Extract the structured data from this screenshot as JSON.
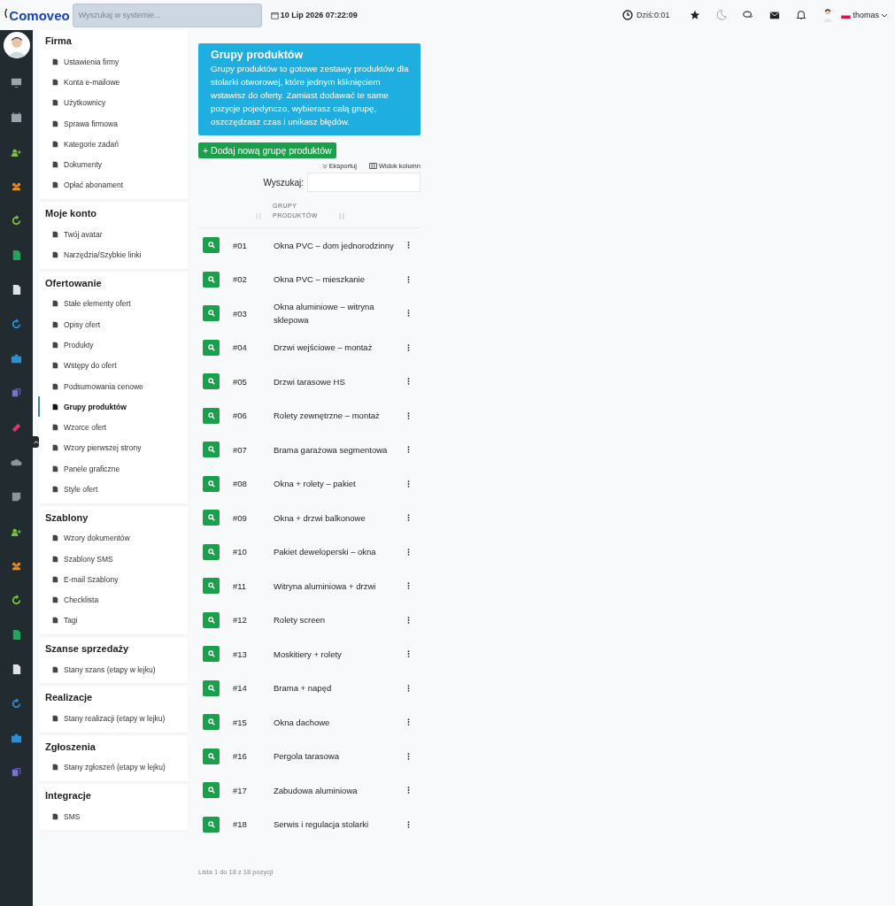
{
  "header": {
    "logo": "Comoveo",
    "logo_mark": "(",
    "search": {
      "placeholder": "Wyszukaj w systemie..."
    },
    "datetime": "10 Lip 2026 07:22:09",
    "today": "Dziś:0:01",
    "user": "thomas"
  },
  "rail": [
    {
      "color": "#9aa5ad"
    },
    {
      "color": "#9aa5ad"
    },
    {
      "color": "#7cc242"
    },
    {
      "color": "#f08c1e"
    },
    {
      "color": "#7cc242"
    },
    {
      "color": "#27a35a"
    },
    {
      "color": "#dfe3e6"
    },
    {
      "color": "#2a8fd6"
    },
    {
      "color": "#2a8fd6"
    },
    {
      "color": "#7b6fd0"
    },
    {
      "color": "#e0356e"
    },
    {
      "color": "#8a959c"
    },
    {
      "color": "#8a959c"
    },
    {
      "color": "#7cc242"
    },
    {
      "color": "#f08c1e"
    },
    {
      "color": "#7cc242"
    },
    {
      "color": "#27a35a"
    },
    {
      "color": "#dfe3e6"
    },
    {
      "color": "#2a8fd6"
    },
    {
      "color": "#2a8fd6"
    },
    {
      "color": "#7b6fd0"
    }
  ],
  "sidebar": [
    {
      "title": "Firma",
      "items": [
        {
          "label": "Ustawienia firmy",
          "selected": false
        },
        {
          "label": "Konta e-mailowe",
          "selected": false
        },
        {
          "label": "Użytkownicy",
          "selected": false
        },
        {
          "label": "Sprawa firmowa",
          "selected": false
        },
        {
          "label": "Kategorie zadań",
          "selected": false
        },
        {
          "label": "Dokumenty",
          "selected": false
        },
        {
          "label": "Opłać abonament",
          "selected": false
        }
      ]
    },
    {
      "title": "Moje konto",
      "items": [
        {
          "label": "Twój avatar",
          "selected": false
        },
        {
          "label": "Narzędzia/Szybkie linki",
          "selected": false
        }
      ]
    },
    {
      "title": "Ofertowanie",
      "items": [
        {
          "label": "Stałe elementy ofert",
          "selected": false
        },
        {
          "label": "Opisy ofert",
          "selected": false
        },
        {
          "label": "Produkty",
          "selected": false
        },
        {
          "label": "Wstępy do ofert",
          "selected": false
        },
        {
          "label": "Podsumowania cenowe",
          "selected": false
        },
        {
          "label": "Grupy produktów",
          "selected": true
        },
        {
          "label": "Wzorce ofert",
          "selected": false
        },
        {
          "label": "Wzory pierwszej strony",
          "selected": false
        },
        {
          "label": "Panele graficzne",
          "selected": false
        },
        {
          "label": "Style ofert",
          "selected": false
        }
      ]
    },
    {
      "title": "Szablony",
      "items": [
        {
          "label": "Wzory dokumentów",
          "selected": false
        },
        {
          "label": "Szablony SMS",
          "selected": false
        },
        {
          "label": "E-mail Szablony",
          "selected": false
        },
        {
          "label": "Checklista",
          "selected": false
        },
        {
          "label": "Tagi",
          "selected": false
        }
      ]
    },
    {
      "title": "Szanse sprzedaży",
      "items": [
        {
          "label": "Stany szans (etapy w lejku)",
          "selected": false
        }
      ]
    },
    {
      "title": "Realizacje",
      "items": [
        {
          "label": "Stany realizacji (etapy w lejku)",
          "selected": false
        }
      ]
    },
    {
      "title": "Zgłoszenia",
      "items": [
        {
          "label": "Stany zgłoszeń (etapy w lejku)",
          "selected": false
        }
      ]
    },
    {
      "title": "Integracje",
      "items": [
        {
          "label": "SMS",
          "selected": false
        }
      ]
    }
  ],
  "info": {
    "title": "Grupy produktów",
    "text": "Grupy produktów to gotowe zestawy produktów dla stolarki otworowej, które jednym kliknięciem wstawisz do oferty. Zamiast dodawać te same pozycje pojedynczo, wybierasz całą grupę, oszczędzasz czas i unikasz błędów."
  },
  "add_button": "+ Dodaj nową grupę produktów",
  "export": "Eksportuj",
  "columns_view": "Widok kolumn",
  "search_label": "Wyszukaj:",
  "table": {
    "columns": [
      "GRUPY PRODUKTÓW"
    ],
    "rows": [
      {
        "id": "#01",
        "name": "Okna PVC – dom jednorodzinny"
      },
      {
        "id": "#02",
        "name": "Okna PVC – mieszkanie"
      },
      {
        "id": "#03",
        "name": "Okna aluminiowe – witryna sklepowa"
      },
      {
        "id": "#04",
        "name": "Drzwi wejściowe – montaż"
      },
      {
        "id": "#05",
        "name": "Drzwi tarasowe HS"
      },
      {
        "id": "#06",
        "name": "Rolety zewnętrzne – montaż"
      },
      {
        "id": "#07",
        "name": "Brama garażowa segmentowa"
      },
      {
        "id": "#08",
        "name": "Okna + rolety – pakiet"
      },
      {
        "id": "#09",
        "name": "Okna + drzwi balkonowe"
      },
      {
        "id": "#10",
        "name": "Pakiet deweloperski – okna"
      },
      {
        "id": "#11",
        "name": "Witryna aluminiowa + drzwi"
      },
      {
        "id": "#12",
        "name": "Rolety screen"
      },
      {
        "id": "#13",
        "name": "Moskitiery + rolety"
      },
      {
        "id": "#14",
        "name": "Brama + napęd"
      },
      {
        "id": "#15",
        "name": "Okna dachowe"
      },
      {
        "id": "#16",
        "name": "Pergola tarasowa"
      },
      {
        "id": "#17",
        "name": "Zabudowa aluminiowa"
      },
      {
        "id": "#18",
        "name": "Serwis i regulacja stolarki"
      }
    ]
  },
  "footer": "Lista 1 do 18 z 18 pozycji"
}
